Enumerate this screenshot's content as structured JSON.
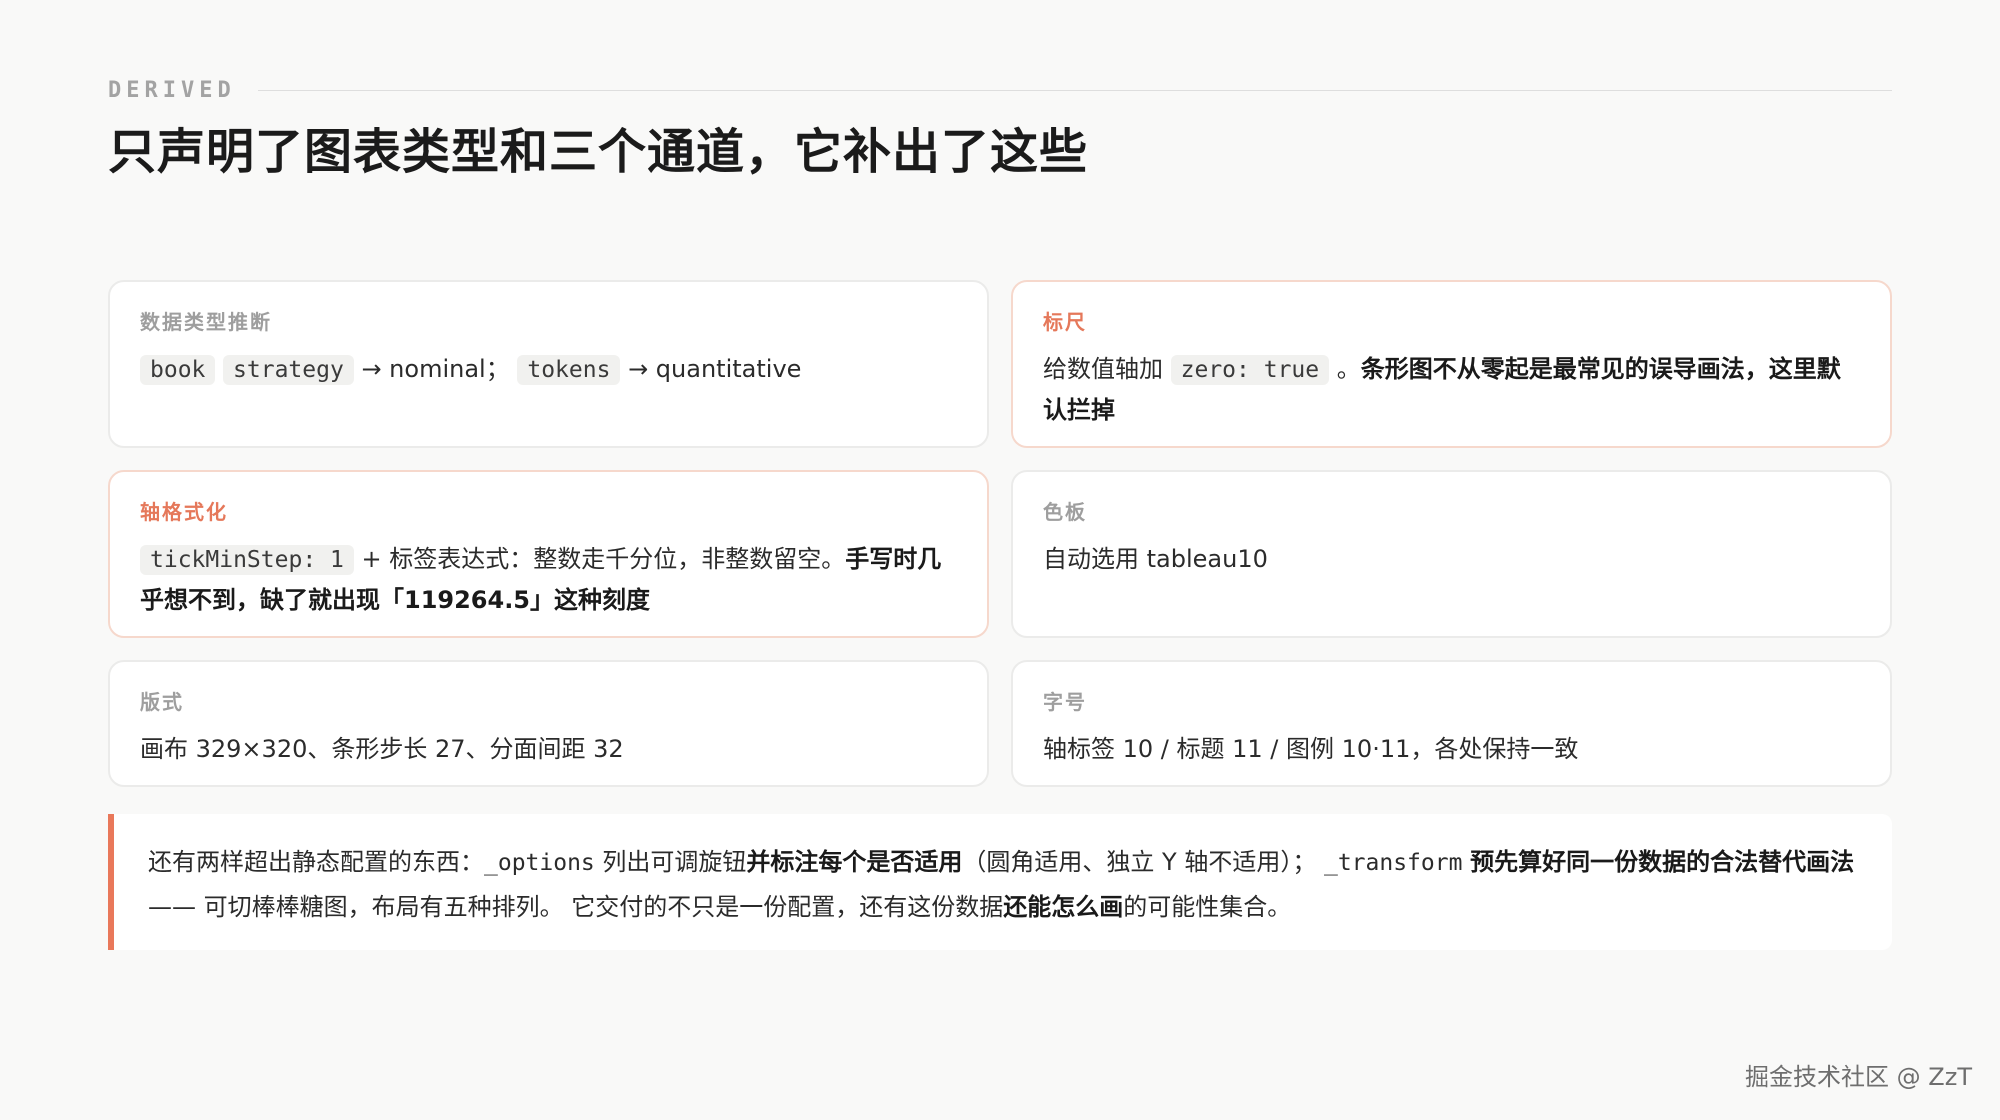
{
  "eyebrow": "DERIVED",
  "title": "只声明了图表类型和三个通道，它补出了这些",
  "cards": {
    "data_types": {
      "label": "数据类型推断",
      "code1": "book",
      "code2": "strategy",
      "text1": " → nominal； ",
      "code3": "tokens",
      "text2": " → quantitative"
    },
    "scale": {
      "label": "标尺",
      "text1": "给数值轴加 ",
      "code1": "zero: true",
      "text2": " 。",
      "strong": "条形图不从零起是最常见的误导画法，这里默认拦掉"
    },
    "axis_format": {
      "label": "轴格式化",
      "code1": "tickMinStep: 1",
      "text1": " + 标签表达式：整数走千分位，非整数留空。",
      "strong": "手写时几乎想不到，缺了就出现「119264.5」这种刻度"
    },
    "palette": {
      "label": "色板",
      "text": "自动选用 tableau10"
    },
    "layout": {
      "label": "版式",
      "text": "画布 329×320、条形步长 27、分面间距 32"
    },
    "font_size": {
      "label": "字号",
      "text": "轴标签 10 / 标题 11 / 图例 10·11，各处保持一致"
    }
  },
  "note": {
    "t1": "还有两样超出静态配置的东西：",
    "code1": "_options",
    "t2": " 列出可调旋钮",
    "s1": "并标注每个是否适用",
    "t3": "（圆角适用、独立 Y 轴不适用）； ",
    "code2": "_transform",
    "t4": " ",
    "s2": "预先算好同一份数据的合法替代画法",
    "t5": " —— 可切棒棒糖图，布局有五种排列。 它交付的不只是一份配置，还有这份数据",
    "s3": "还能怎么画",
    "t6": "的可能性集合。"
  },
  "watermark": "掘金技术社区 @ ZzT"
}
